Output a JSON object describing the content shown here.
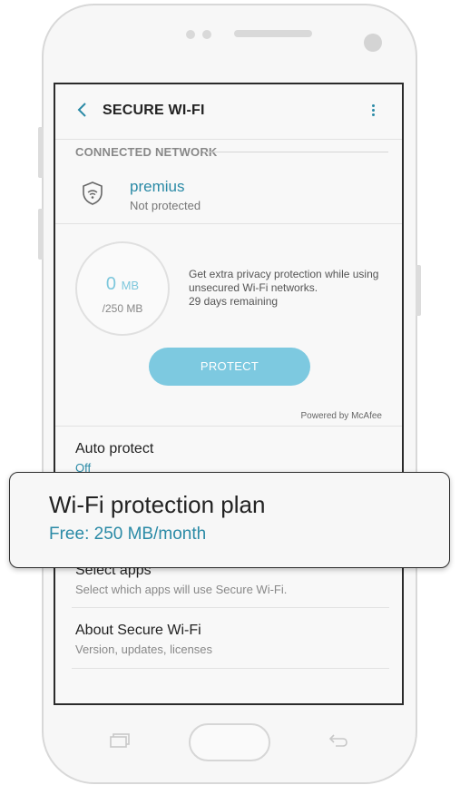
{
  "header": {
    "title": "SECURE WI-FI"
  },
  "connected_network": {
    "section_label": "CONNECTED NETWORK",
    "name": "premius",
    "status": "Not protected"
  },
  "usage": {
    "used_value": "0",
    "used_unit": "MB",
    "total": "/250 MB",
    "used_fraction": 0
  },
  "promo": {
    "line1": "Get extra privacy protection while using unsecured Wi-Fi networks.",
    "line2": "29 days remaining"
  },
  "protect_button": {
    "label": "PROTECT"
  },
  "powered_by": "Powered by McAfee",
  "settings": {
    "auto_protect": {
      "title": "Auto protect",
      "value": "Off"
    },
    "select_apps": {
      "title": "Select apps",
      "subtitle": "Select which apps will use Secure Wi-Fi."
    },
    "about": {
      "title": "About Secure Wi-Fi",
      "subtitle": "Version, updates, licenses"
    }
  },
  "callout": {
    "title": "Wi-Fi protection plan",
    "subtitle": "Free: 250 MB/month"
  },
  "colors": {
    "accent": "#2a8aa6",
    "button": "#7dc9e0",
    "gauge_text": "#7dc7dc"
  },
  "icons": [
    "back-arrow-icon",
    "more-vert-icon",
    "wifi-shield-icon",
    "recent-apps-icon",
    "home-button",
    "back-key-icon"
  ]
}
